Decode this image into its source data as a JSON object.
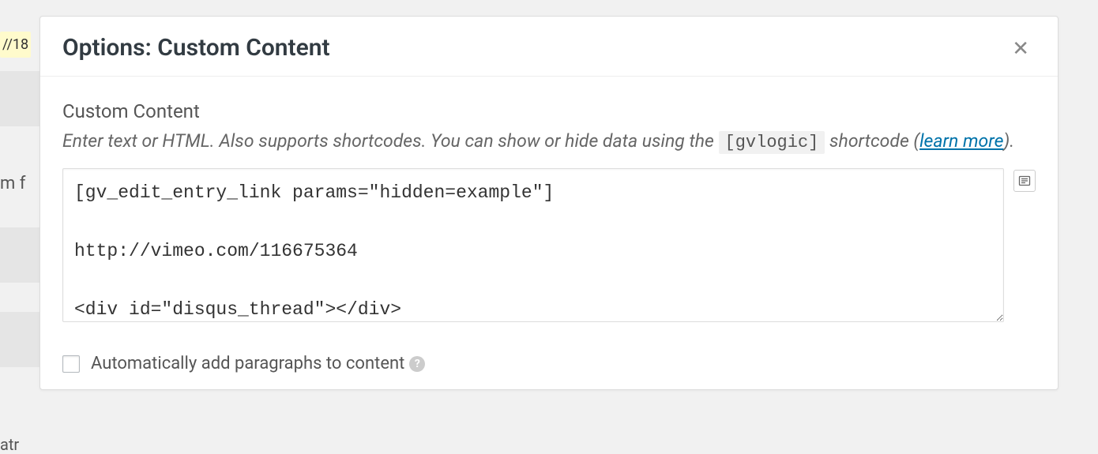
{
  "background": {
    "fragment1": "//18",
    "fragment2": "m f",
    "fragment3": "atr"
  },
  "modal": {
    "title": "Options: Custom Content",
    "close_label": "✕",
    "section_heading": "Custom Content",
    "description_part1": "Enter text or HTML. Also supports shortcodes. You can show or hide data using the ",
    "description_code": "[gvlogic]",
    "description_part2": " shortcode (",
    "description_link": "learn more",
    "description_part3": ").",
    "textarea_value": "[gv_edit_entry_link params=\"hidden=example\"]\n\nhttp://vimeo.com/116675364\n\n<div id=\"disqus_thread\"></div>",
    "checkbox_label": "Automatically add paragraphs to content",
    "help_icon": "?"
  }
}
